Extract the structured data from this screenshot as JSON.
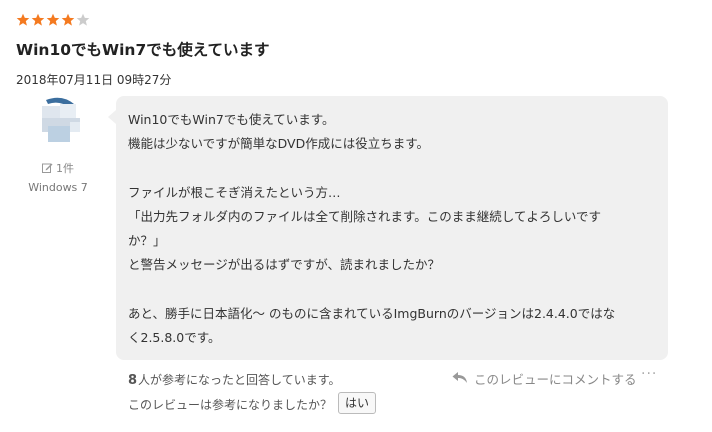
{
  "review": {
    "rating": 4,
    "max_rating": 5,
    "title": "Win10でもWin7でも使えています",
    "date": "2018年07月11日 09時27分",
    "author": {
      "edit_count": "1件",
      "os": "Windows 7"
    },
    "body_lines": [
      "Win10でもWin7でも使えています。",
      "機能は少ないですが簡単なDVD作成には役立ちます。",
      "",
      "ファイルが根こそぎ消えたという方…",
      "「出力先フォルダ内のファイルは全て削除されます。このまま継続してよろしいです",
      "か？」",
      "と警告メッセージが出るはずですが、読まれましたか？",
      "",
      "あと、勝手に日本語化～ のものに含まれているImgBurnのバージョンは2.4.4.0ではな",
      "く2.5.8.0です。"
    ],
    "helpful_count": "8",
    "helpful_text": "人が参考になったと回答しています。",
    "comment_link": "このレビューにコメントする",
    "more_menu": "···",
    "helpful_question": "このレビューは参考になりましたか？",
    "yes_button": "はい"
  },
  "colors": {
    "star_filled": "#f47a20",
    "star_empty": "#cccccc",
    "bubble_bg": "#f0f0f0"
  },
  "icons": [
    "star-icon",
    "pencil-icon",
    "reply-icon",
    "avatar-image"
  ]
}
